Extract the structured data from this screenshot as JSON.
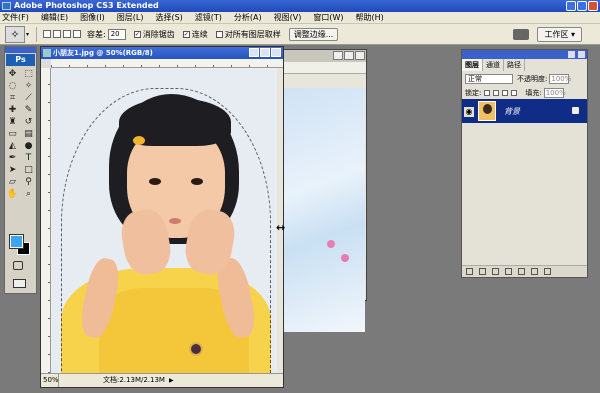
{
  "app": {
    "title": "Adobe Photoshop CS3 Extended"
  },
  "menu": [
    "文件(F)",
    "编辑(E)",
    "图像(I)",
    "图层(L)",
    "选择(S)",
    "滤镜(T)",
    "分析(A)",
    "视图(V)",
    "窗口(W)",
    "帮助(H)"
  ],
  "options": {
    "tolerance_label": "容差:",
    "tolerance_value": "20",
    "antialias_label": "消除锯齿",
    "contiguous_label": "连续",
    "sample_all_label": "对所有图层取样",
    "refine_edge_label": "调整边缘...",
    "workspace_label": "工作区 ▾"
  },
  "toolbox": {
    "logo": "Ps",
    "icons": [
      "move-tool-icon",
      "marquee-tool-icon",
      "lasso-tool-icon",
      "magic-wand-tool-icon",
      "crop-tool-icon",
      "slice-tool-icon",
      "healing-brush-icon",
      "brush-tool-icon",
      "clone-stamp-icon",
      "history-brush-icon",
      "eraser-tool-icon",
      "gradient-tool-icon",
      "blur-tool-icon",
      "dodge-tool-icon",
      "pen-tool-icon",
      "type-tool-icon",
      "path-select-icon",
      "shape-tool-icon",
      "notes-tool-icon",
      "eyedropper-icon",
      "hand-tool-icon",
      "zoom-tool-icon"
    ],
    "fg_color": "#3da3f2",
    "bg_color": "#000000"
  },
  "document": {
    "title": "小朋友1.jpg @ 50%(RGB/8)",
    "zoom": "50%",
    "doc_size": "文档:2.13M/2.13M"
  },
  "layers_panel": {
    "tabs": [
      "图层",
      "通道",
      "路径"
    ],
    "blend_mode": "正常",
    "opacity_label": "不透明度:",
    "opacity_value": "100%",
    "lock_label": "锁定:",
    "fill_label": "填充:",
    "fill_value": "100%",
    "layer_name": "背景"
  }
}
